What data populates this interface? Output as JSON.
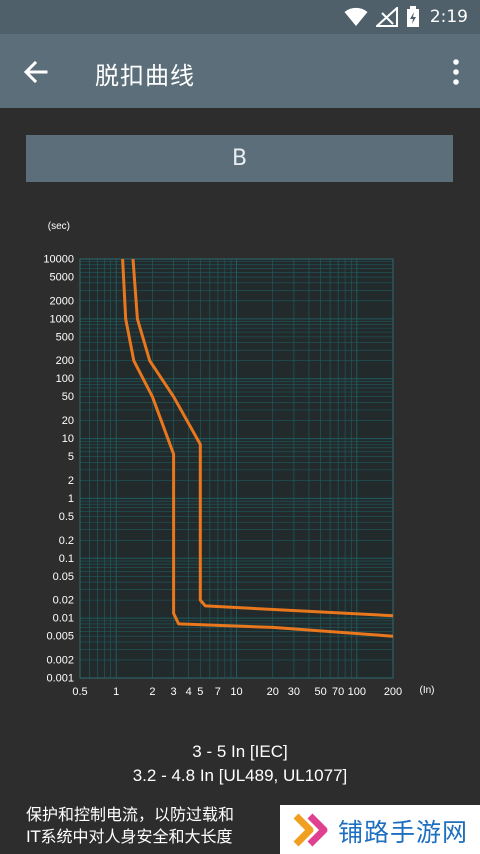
{
  "status_bar": {
    "time": "2:19"
  },
  "app_bar": {
    "title": "脱扣曲线"
  },
  "curve_type_button": {
    "label": "B"
  },
  "chart_data": {
    "type": "line",
    "x_scale": "log",
    "y_scale": "log",
    "xlabel": "(In)",
    "ylabel": "(sec)",
    "xlim": [
      0.5,
      200
    ],
    "ylim": [
      0.001,
      10000
    ],
    "x_ticks": [
      0.5,
      1,
      2,
      3,
      4,
      5,
      7,
      10,
      20,
      30,
      50,
      70,
      100,
      200
    ],
    "x_tick_labels": [
      "0.5",
      "1",
      "2",
      "3",
      "4",
      "5",
      "7",
      "10",
      "20",
      "30",
      "50",
      "70",
      "100",
      "200"
    ],
    "y_ticks": [
      10000,
      5000,
      2000,
      1000,
      500,
      200,
      100,
      50,
      20,
      10,
      5,
      2,
      1,
      0.5,
      0.2,
      0.1,
      0.05,
      0.02,
      0.01,
      0.005,
      0.002,
      0.001
    ],
    "y_tick_labels": [
      "10000",
      "5000",
      "2000",
      "1000",
      "500",
      "200",
      "100",
      "50",
      "20",
      "10",
      "5",
      "2",
      "1",
      "0.5",
      "0.2",
      "0.1",
      "0.05",
      "0.02",
      "0.01",
      "0.005",
      "0.002",
      "0.001"
    ],
    "grid": true,
    "series_color": "#e8771d",
    "series": [
      {
        "points": [
          [
            1.13,
            10000
          ],
          [
            1.2,
            1000
          ],
          [
            1.4,
            200
          ],
          [
            2.0,
            50
          ],
          [
            3.0,
            5.5
          ],
          [
            3.0,
            0.012
          ],
          [
            3.3,
            0.008
          ],
          [
            20,
            0.007
          ],
          [
            200,
            0.005
          ]
        ]
      },
      {
        "points": [
          [
            1.38,
            10000
          ],
          [
            1.5,
            1000
          ],
          [
            1.9,
            200
          ],
          [
            3.0,
            50
          ],
          [
            5.0,
            8
          ],
          [
            5.0,
            0.02
          ],
          [
            5.5,
            0.016
          ],
          [
            200,
            0.011
          ]
        ]
      }
    ]
  },
  "spec": {
    "line1": "3 - 5 In  [IEC]",
    "line2": "3.2 - 4.8 In  [UL489, UL1077]"
  },
  "description": {
    "line1": "保护和控制电流，以防过载和",
    "line2": "IT系统中对人身安全和大长度"
  },
  "watermark": {
    "text": "铺路手游网"
  }
}
